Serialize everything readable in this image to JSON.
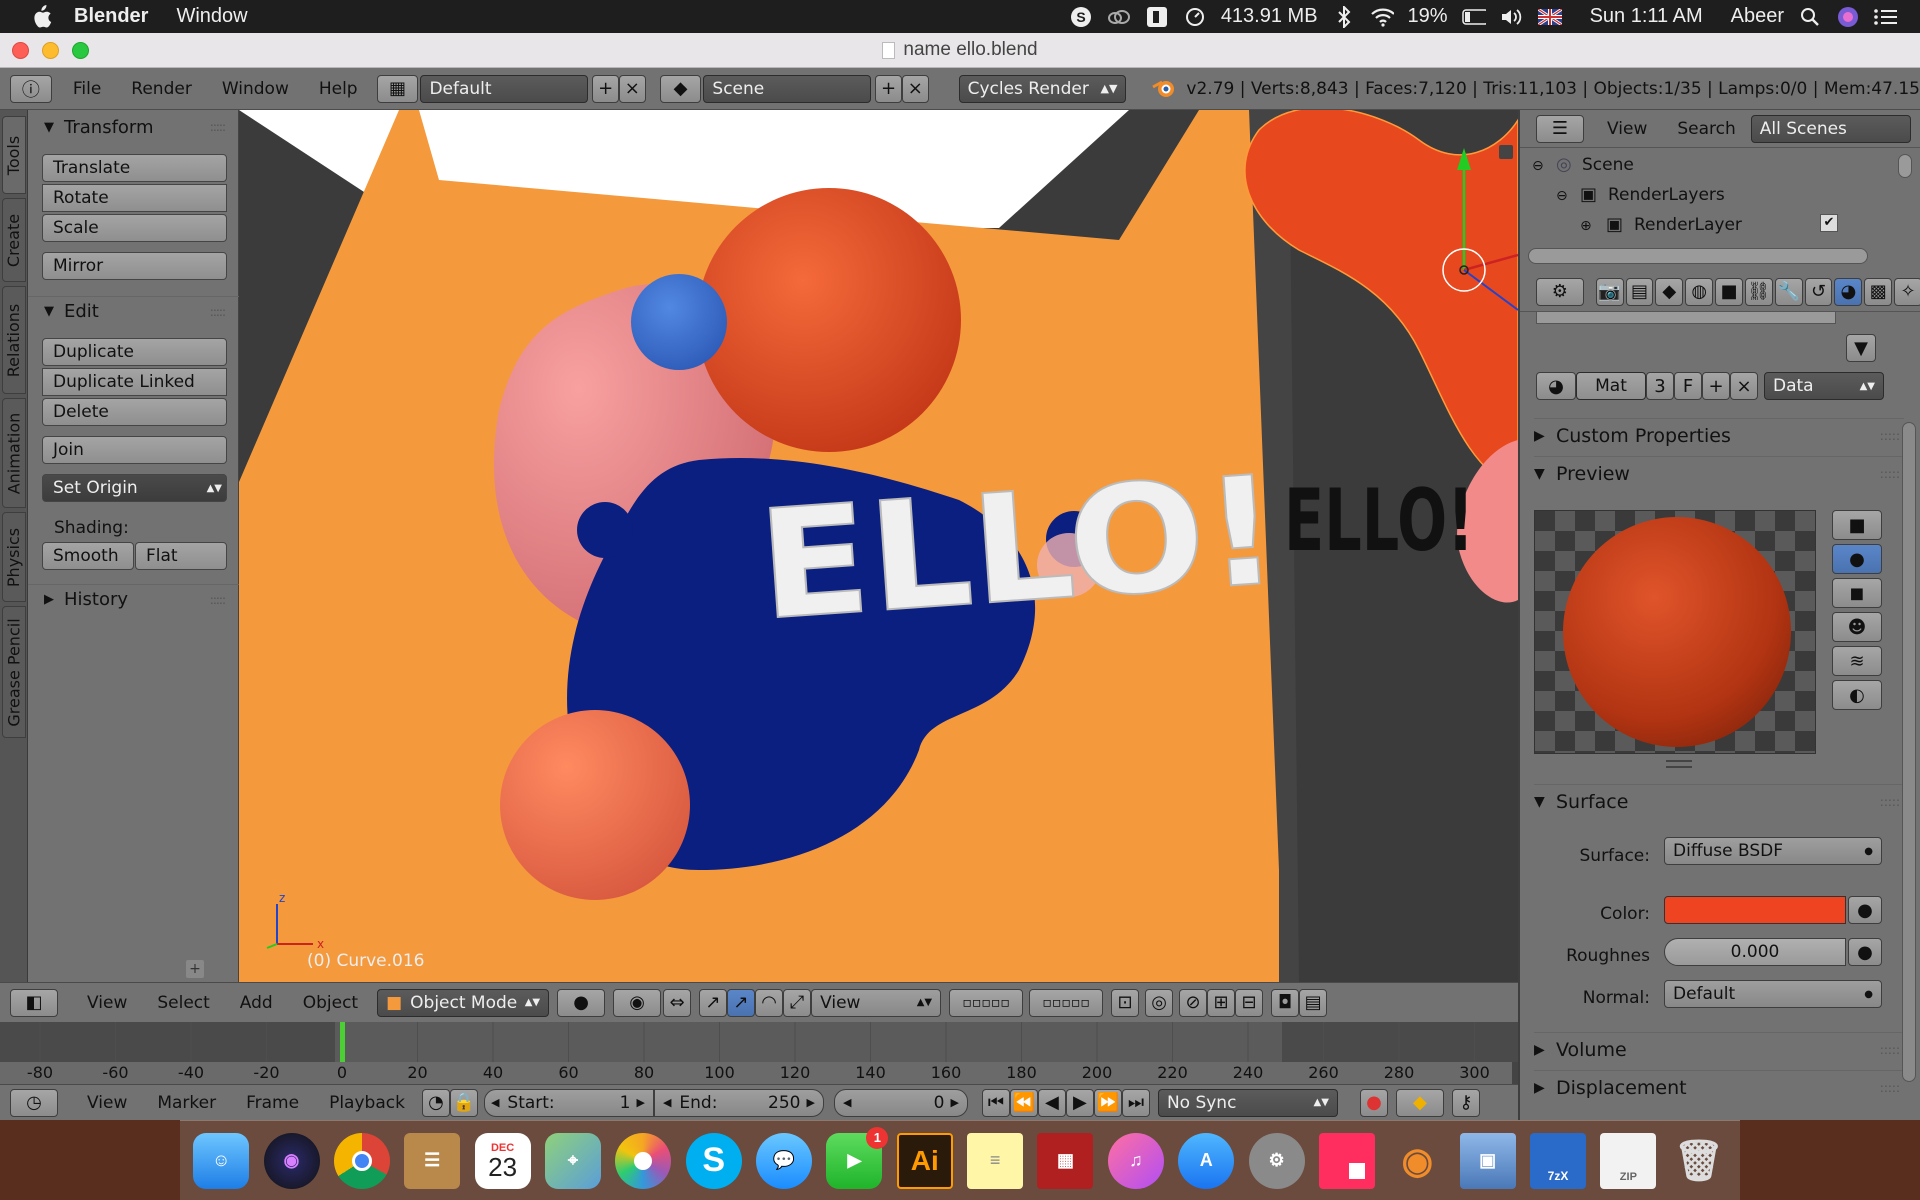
{
  "macmenu": {
    "app_name": "Blender",
    "items": [
      "Window"
    ],
    "memory": "413.91 MB",
    "battery": "19%",
    "time": "Sun 1:11 AM",
    "user": "Abeer"
  },
  "window": {
    "title": "name ello.blend"
  },
  "header": {
    "menus": [
      "File",
      "Render",
      "Window",
      "Help"
    ],
    "layout": "Default",
    "scene": "Scene",
    "engine": "Cycles Render",
    "stats": "v2.79 | Verts:8,843 | Faces:7,120 | Tris:11,103 | Objects:1/35 | Lamps:0/0 | Mem:47.15"
  },
  "tabs": [
    "Tools",
    "Create",
    "Relations",
    "Animation",
    "Physics",
    "Grease Pencil"
  ],
  "toolshelf": {
    "transform_title": "Transform",
    "translate": "Translate",
    "rotate": "Rotate",
    "scale": "Scale",
    "mirror": "Mirror",
    "edit_title": "Edit",
    "duplicate": "Duplicate",
    "duplicate_linked": "Duplicate Linked",
    "delete": "Delete",
    "join": "Join",
    "set_origin": "Set Origin",
    "shading_label": "Shading:",
    "smooth": "Smooth",
    "flat": "Flat",
    "history_title": "History"
  },
  "viewport": {
    "object_info": "(0) Curve.016",
    "text_main": "ELLO!",
    "text_shadow": "ELLO!",
    "axis_z": "z",
    "axis_x": "x"
  },
  "viewheader": {
    "menus": [
      "View",
      "Select",
      "Add",
      "Object"
    ],
    "mode": "Object Mode",
    "pivot": "View"
  },
  "timeline": {
    "ticks": [
      "-80",
      "-60",
      "-40",
      "-20",
      "0",
      "20",
      "40",
      "60",
      "80",
      "100",
      "120",
      "140",
      "160",
      "180",
      "200",
      "220",
      "240",
      "260",
      "280",
      "300"
    ],
    "current_frame_marker": 0
  },
  "tlheader": {
    "menus": [
      "View",
      "Marker",
      "Frame",
      "Playback"
    ],
    "start_label": "Start:",
    "start_value": "1",
    "end_label": "End:",
    "end_value": "250",
    "current": "0",
    "sync": "No Sync"
  },
  "outliner": {
    "view": "View",
    "search": "Search",
    "filter": "All Scenes",
    "scene": "Scene",
    "renderlayers": "RenderLayers",
    "renderlayer": "RenderLayer"
  },
  "props": {
    "mat_name": "Mat",
    "mat_users": "3",
    "mat_fake": "F",
    "data_select": "Data",
    "custom_properties": "Custom Properties",
    "preview": "Preview",
    "surface_title": "Surface",
    "surface_label": "Surface:",
    "surface_value": "Diffuse BSDF",
    "color_label": "Color:",
    "color_value": "#ee4422",
    "roughness_label": "Roughnes",
    "roughness_value": "0.000",
    "normal_label": "Normal:",
    "normal_value": "Default",
    "volume": "Volume",
    "displacement": "Displacement"
  },
  "dock": {
    "calendar_month": "DEC",
    "calendar_day": "23",
    "facetime_badge": "1",
    "illustrator": "Ai",
    "zip1": "7zX",
    "zip2": "ZIP"
  }
}
